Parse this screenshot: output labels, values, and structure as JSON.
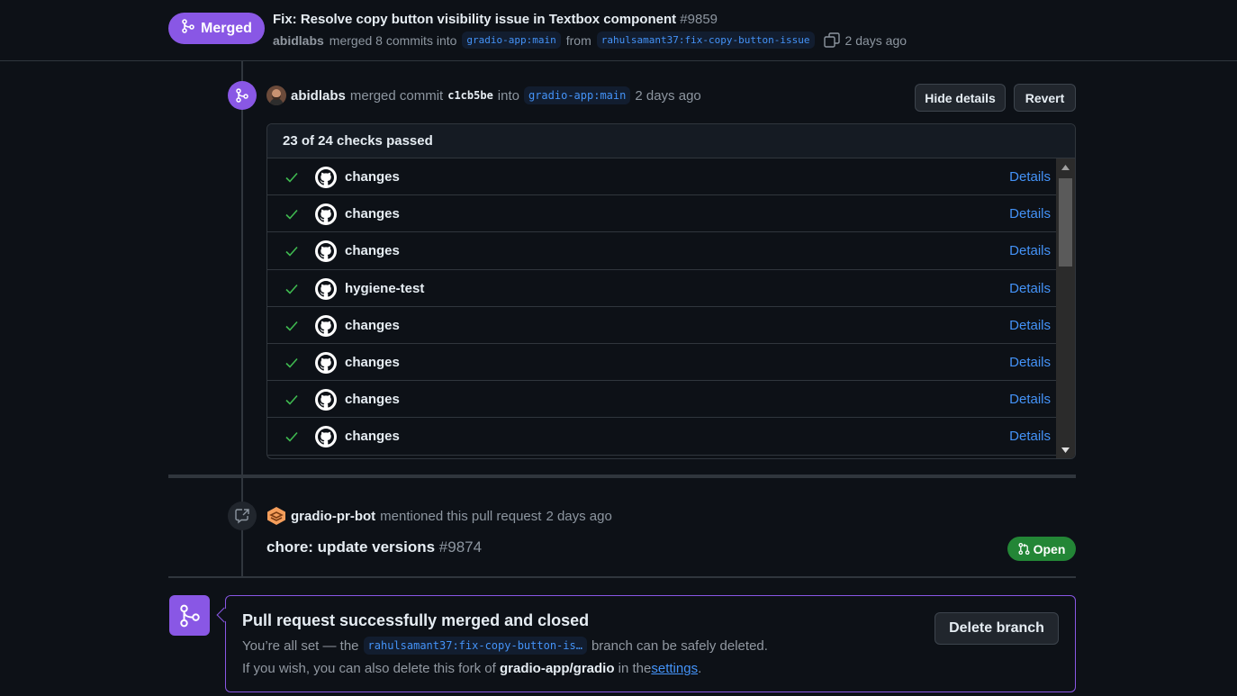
{
  "header": {
    "status": "Merged",
    "title": "Fix: Resolve copy button visibility issue in Textbox component",
    "number": "#9859",
    "author": "abidlabs",
    "merged_text": "merged 8 commits into",
    "base_branch": "gradio-app:main",
    "from_text": "from",
    "head_branch": "rahulsamant37:fix-copy-button-issue",
    "time": "2 days ago"
  },
  "merge_event": {
    "user": "abidlabs",
    "action": "merged commit",
    "sha": "c1cb5be",
    "into": "into",
    "branch": "gradio-app:main",
    "time": "2 days ago",
    "hide_details": "Hide details",
    "revert": "Revert"
  },
  "checks": {
    "summary": "23 of 24 checks passed",
    "details_label": "Details",
    "items": [
      {
        "name": "changes",
        "status": "success"
      },
      {
        "name": "changes",
        "status": "success"
      },
      {
        "name": "changes",
        "status": "success"
      },
      {
        "name": "hygiene-test",
        "status": "success"
      },
      {
        "name": "changes",
        "status": "success"
      },
      {
        "name": "changes",
        "status": "success"
      },
      {
        "name": "changes",
        "status": "success"
      },
      {
        "name": "changes",
        "status": "success"
      }
    ]
  },
  "mention_event": {
    "user": "gradio-pr-bot",
    "text": "mentioned this pull request",
    "time": "2 days ago",
    "pr_title": "chore: update versions",
    "pr_number": "#9874",
    "pr_status": "Open"
  },
  "merged_box": {
    "title": "Pull request successfully merged and closed",
    "line1_pre": "You’re all set — the",
    "line1_branch": "rahulsamant37:fix-copy-button-is…",
    "line1_post": "branch can be safely deleted.",
    "line2_pre": "If you wish, you can also delete this fork of",
    "line2_repo": "gradio-app/gradio",
    "line2_mid": "in the",
    "line2_link": "settings",
    "line2_end": ".",
    "delete_button": "Delete branch"
  },
  "colors": {
    "merged": "#8957e5",
    "open": "#238636",
    "link": "#4493f8",
    "success": "#3fb950"
  }
}
